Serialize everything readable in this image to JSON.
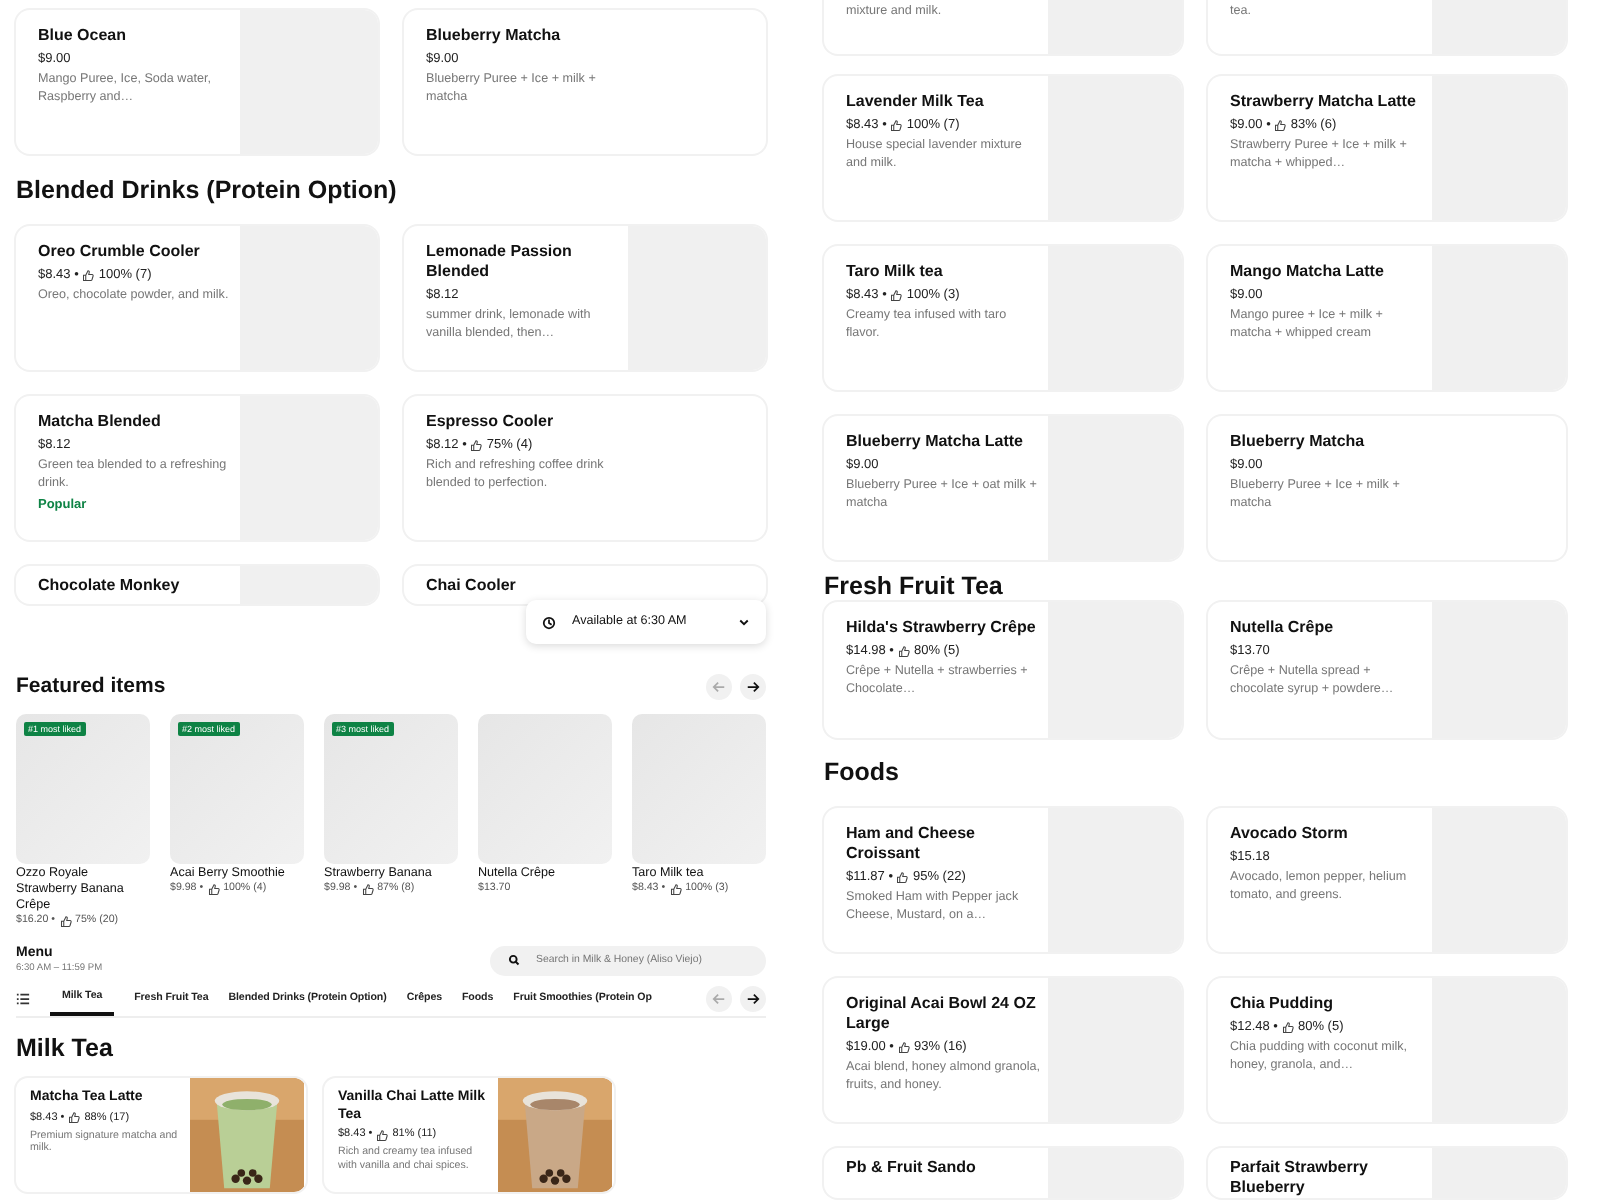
{
  "left_panel": {
    "cards": [
      {
        "name": "Blue Ocean",
        "price": "$9.00",
        "description": "Mango Puree, Ice, Soda water, Raspberry and…",
        "kind": "placeholder"
      },
      {
        "name": "Blueberry Matcha",
        "price": "$9.00",
        "description": "Blueberry Puree + Ice + milk + matcha",
        "kind": "plain"
      }
    ],
    "section": {
      "title": "Blended Drinks (Protein Option)",
      "items": [
        {
          "name": "Oreo Crumble Cooler",
          "price": "$8.43 •",
          "rating": "100% (7)",
          "description": "Oreo, chocolate powder, and milk.",
          "kind": "placeholder"
        },
        {
          "name": "Lemonade Passion Blended",
          "price": "$8.12",
          "description": "summer drink, lemonade with vanilla blended, then…",
          "kind": "placeholder"
        },
        {
          "name": "Matcha Blended",
          "price": "$8.12",
          "description": "Green tea blended to a refreshing drink.",
          "tag": "Popular",
          "kind": "placeholder"
        },
        {
          "name": "Espresso Cooler",
          "price": "$8.12 •",
          "rating": "75% (4)",
          "description": "Rich and refreshing coffee drink blended to perfection.",
          "kind": "plain"
        },
        {
          "name": "Chocolate Monkey",
          "kind": "placeholder"
        },
        {
          "name": "Chai Cooler",
          "kind": "plain"
        }
      ]
    },
    "availability": {
      "label": "Available at 6:30 AM"
    },
    "featured": {
      "title": "Featured items",
      "items": [
        {
          "badge": "#1 most liked",
          "name": "Ozzo Royale Strawberry Banana Crêpe",
          "price": "$16.20 •",
          "rating": "75% (20)"
        },
        {
          "badge": "#2 most liked",
          "name": "Acai Berry Smoothie",
          "price": "$9.98 •",
          "rating": "100% (4)"
        },
        {
          "badge": "#3 most liked",
          "name": "Strawberry Banana",
          "price": "$9.98 •",
          "rating": "87% (8)"
        },
        {
          "name": "Nutella Crêpe",
          "price": "$13.70"
        },
        {
          "name": "Taro Milk tea",
          "price": "$8.43 •",
          "rating": "100% (3)"
        }
      ]
    },
    "menu": {
      "title": "Menu",
      "hours": "6:30 AM – 11:59 PM",
      "search": {
        "placeholder": "Search in Milk & Honey (Aliso Viejo)"
      },
      "tabs": [
        {
          "label": "Milk Tea",
          "selected": true
        },
        {
          "label": "Fresh Fruit Tea",
          "selected": false
        },
        {
          "label": "Blended Drinks (Protein Option)",
          "selected": false
        },
        {
          "label": "Crêpes",
          "selected": false
        },
        {
          "label": "Foods",
          "selected": false
        },
        {
          "label": "Fruit Smoothies (Protein Op",
          "selected": false
        }
      ]
    },
    "milk_tea": {
      "title": "Milk Tea",
      "items": [
        {
          "name": "Matcha Tea Latte",
          "price": "$8.43 •",
          "rating": "88% (17)",
          "description": "Premium signature matcha and milk."
        },
        {
          "name": "Vanilla Chai Latte Milk Tea",
          "price": "$8.43 •",
          "rating": "81% (11)",
          "description": "Rich and creamy tea infused with vanilla and chai spices."
        }
      ]
    }
  },
  "right_panel": {
    "top_cards": [
      {
        "description": "mixture and milk.",
        "kind": "placeholder"
      },
      {
        "description": "tea.",
        "kind": "placeholder"
      }
    ],
    "cards": [
      {
        "name": "Lavender Milk Tea",
        "price": "$8.43 •",
        "rating": "100% (7)",
        "description": "House special lavender mixture and milk.",
        "kind": "placeholder"
      },
      {
        "name": "Strawberry Matcha Latte",
        "price": "$9.00 •",
        "rating": "83% (6)",
        "description": "Strawberry Puree + Ice + milk + matcha + whipped…",
        "kind": "placeholder"
      },
      {
        "name": "Taro Milk tea",
        "price": "$8.43 •",
        "rating": "100% (3)",
        "description": "Creamy tea infused with taro flavor.",
        "kind": "placeholder"
      },
      {
        "name": "Mango Matcha Latte",
        "price": "$9.00",
        "description": "Mango puree + Ice + milk + matcha + whipped cream",
        "kind": "placeholder"
      },
      {
        "name": "Blueberry Matcha Latte",
        "price": "$9.00",
        "description": "Blueberry Puree + Ice + oat milk + matcha",
        "kind": "placeholder"
      },
      {
        "name": "Blueberry Matcha",
        "price": "$9.00",
        "description": "Blueberry Puree + Ice + milk + matcha",
        "kind": "plain"
      }
    ],
    "sections": [
      {
        "title": "Fresh Fruit Tea",
        "items": [
          {
            "name": "Hilda's Strawberry Crêpe",
            "price": "$14.98 •",
            "rating": "80% (5)",
            "description": "Crêpe + Nutella + strawberries + Chocolate…",
            "kind": "placeholder"
          },
          {
            "name": "Nutella Crêpe",
            "price": "$13.70",
            "description": "Crêpe + Nutella spread + chocolate syrup + powdere…",
            "kind": "placeholder"
          }
        ]
      },
      {
        "title": "Foods",
        "items": [
          {
            "name": "Ham and Cheese Croissant",
            "price": "$11.87 •",
            "rating": "95% (22)",
            "description": "Smoked Ham with Pepper jack Cheese, Mustard, on a…",
            "kind": "placeholder"
          },
          {
            "name": "Avocado Storm",
            "price": "$15.18",
            "description": "Avocado, lemon pepper, helium tomato, and greens.",
            "kind": "placeholder"
          },
          {
            "name": "Original Acai Bowl 24 OZ Large",
            "price": "$19.00 •",
            "rating": "93% (16)",
            "description": "Acai blend, honey almond granola, fruits, and honey.",
            "kind": "placeholder"
          },
          {
            "name": "Chia Pudding",
            "price": "$12.48 •",
            "rating": "80% (5)",
            "description": "Chia pudding with coconut milk, honey, granola, and…",
            "kind": "placeholder"
          },
          {
            "name": "Pb & Fruit Sando",
            "kind": "placeholder"
          },
          {
            "name": "Parfait Strawberry Blueberry",
            "kind": "placeholder"
          }
        ]
      }
    ]
  }
}
